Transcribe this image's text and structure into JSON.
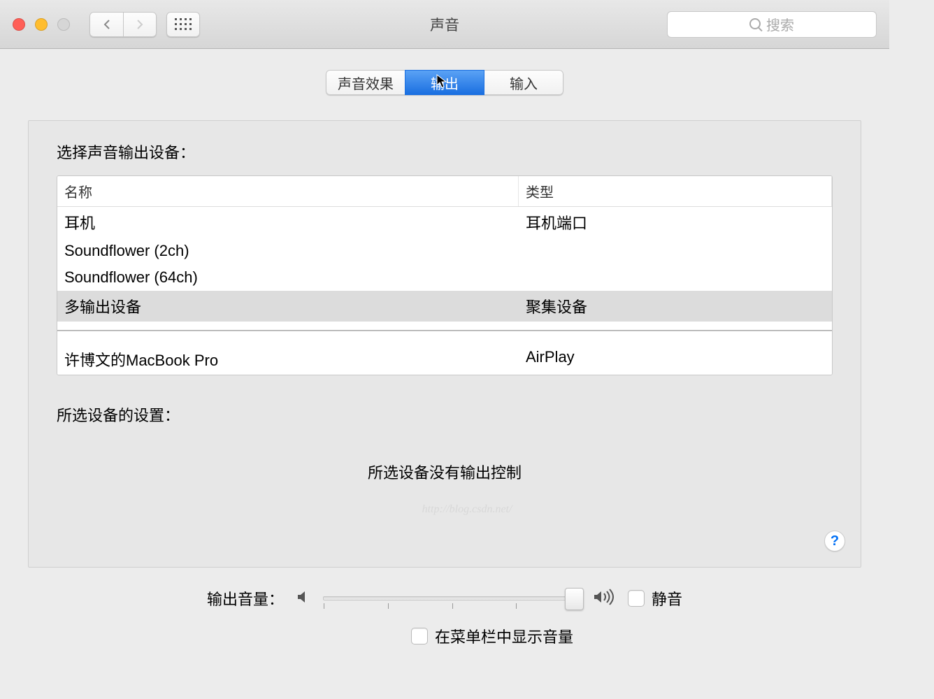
{
  "window": {
    "title": "声音"
  },
  "toolbar": {
    "search_placeholder": "搜索"
  },
  "tabs": {
    "effects": "声音效果",
    "output": "输出",
    "input": "输入"
  },
  "output": {
    "select_label": "选择声音输出设备：",
    "columns": {
      "name": "名称",
      "type": "类型"
    },
    "devices": [
      {
        "name": "耳机",
        "type": "耳机端口"
      },
      {
        "name": "Soundflower (2ch)",
        "type": ""
      },
      {
        "name": "Soundflower (64ch)",
        "type": ""
      },
      {
        "name": "多输出设备",
        "type": "聚集设备"
      },
      {
        "name": "许博文的MacBook Pro",
        "type": "AirPlay"
      }
    ],
    "selected_settings_label": "所选设备的设置：",
    "no_controls": "所选设备没有输出控制"
  },
  "footer": {
    "volume_label": "输出音量：",
    "mute_label": "静音",
    "menubar_label": "在菜单栏中显示音量"
  },
  "help": {
    "symbol": "?"
  },
  "watermark": "http://blog.csdn.net/"
}
